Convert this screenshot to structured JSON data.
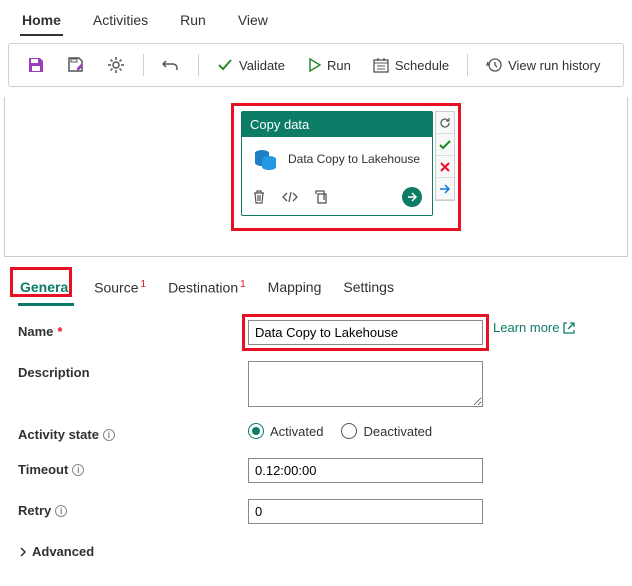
{
  "topTabs": {
    "home": "Home",
    "activities": "Activities",
    "run": "Run",
    "view": "View"
  },
  "toolbar": {
    "validate": "Validate",
    "run": "Run",
    "schedule": "Schedule",
    "history": "View run history"
  },
  "activity": {
    "header": "Copy data",
    "name": "Data Copy to Lakehouse"
  },
  "panelTabs": {
    "general": "General",
    "source": "Source",
    "destination": "Destination",
    "mapping": "Mapping",
    "settings": "Settings"
  },
  "form": {
    "nameLabel": "Name",
    "nameValue": "Data Copy to Lakehouse",
    "learnMore": "Learn more",
    "descriptionLabel": "Description",
    "descriptionValue": "",
    "activityStateLabel": "Activity state",
    "activated": "Activated",
    "deactivated": "Deactivated",
    "timeoutLabel": "Timeout",
    "timeoutValue": "0.12:00:00",
    "retryLabel": "Retry",
    "retryValue": "0",
    "advanced": "Advanced"
  }
}
